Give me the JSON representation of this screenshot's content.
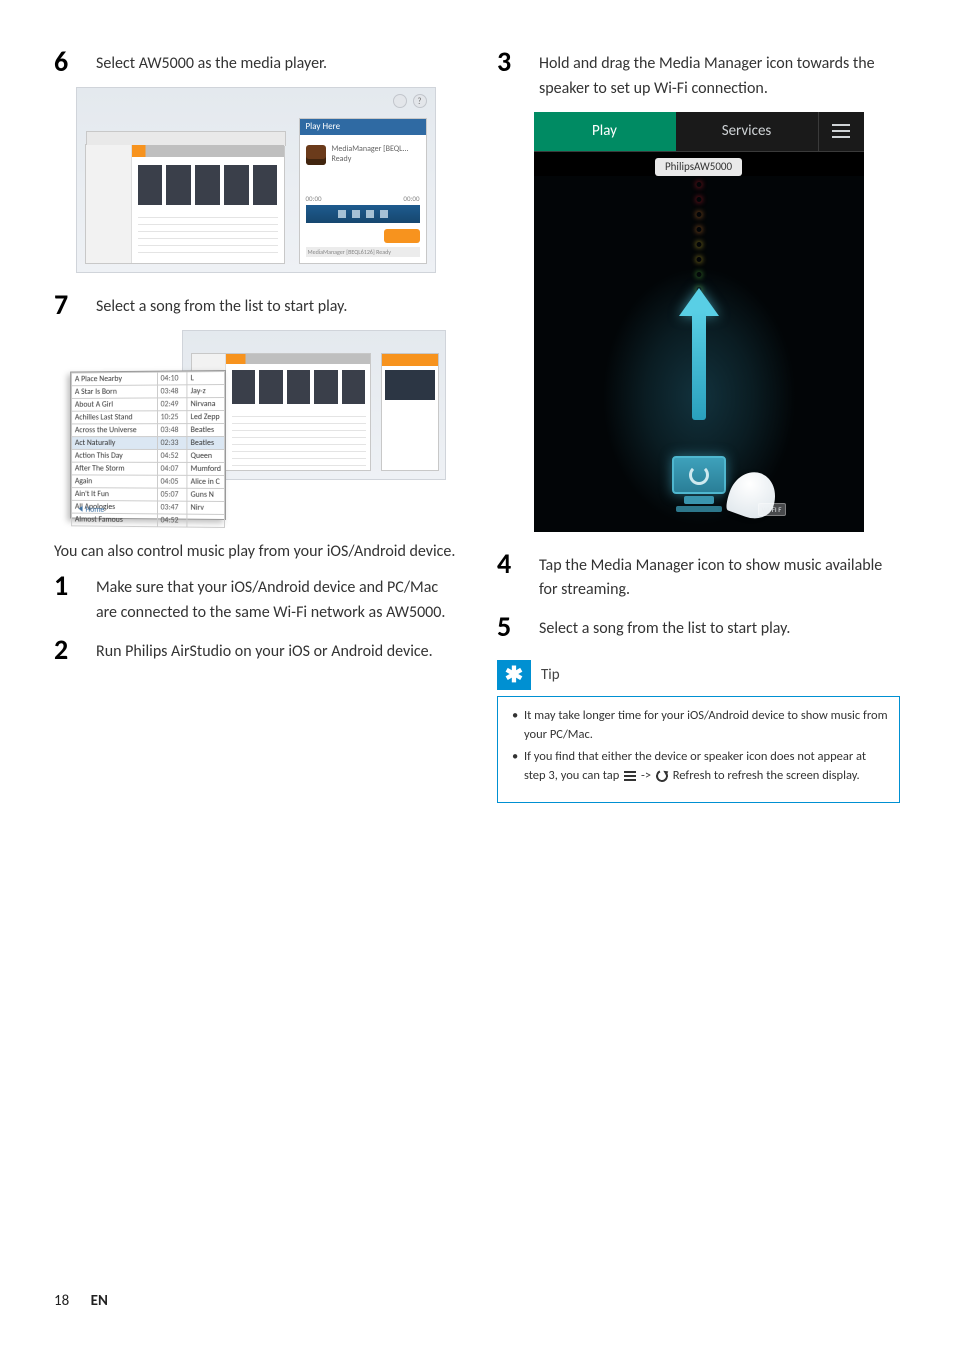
{
  "left": {
    "step6": {
      "num": "6",
      "text": "Select AW5000 as the media player."
    },
    "step7": {
      "num": "7",
      "text": "Select a song from the list to start play."
    },
    "paragraph": "You can also control music play from your iOS/Android device.",
    "sub1": {
      "num": "1",
      "text_a": "Make sure that your iOS/Android device and PC/Mac are connected to the same Wi-Fi network as AW5000."
    },
    "sub2": {
      "num": "2",
      "text_a": "Run ",
      "bold": "Philips AirStudio",
      "text_b": " on your iOS or Android device."
    }
  },
  "right": {
    "step3": {
      "num": "3",
      "text": "Hold and drag the Media Manager icon towards the speaker to set up Wi-Fi connection."
    },
    "step4": {
      "num": "4",
      "text": "Tap the Media Manager icon to show music available for streaming."
    },
    "step5": {
      "num": "5",
      "text": "Select a song from the list to start play."
    }
  },
  "fig6": {
    "help1": " ",
    "help2": "?",
    "play_here": "Play Here",
    "device_line1": "MediaManager [BEQL...",
    "device_line2": "Ready",
    "time_a": "00:00",
    "time_b": "00:00",
    "bottom_label": "MediaManager [BEQL6126] Ready"
  },
  "fig7": {
    "songs": [
      {
        "t": "A Place Nearby",
        "d": "04:10",
        "a": "L"
      },
      {
        "t": "A Star Is Born",
        "d": "03:48",
        "a": "Jay-z"
      },
      {
        "t": "About A Girl",
        "d": "02:49",
        "a": "Nirvana"
      },
      {
        "t": "Achilles Last Stand",
        "d": "10:25",
        "a": "Led Zepp"
      },
      {
        "t": "Across the Universe",
        "d": "03:48",
        "a": "Beatles"
      },
      {
        "t": "Act Naturally",
        "d": "02:33",
        "a": "Beatles"
      },
      {
        "t": "Action This Day",
        "d": "04:52",
        "a": "Queen"
      },
      {
        "t": "After The Storm",
        "d": "04:07",
        "a": "Mumford"
      },
      {
        "t": "Again",
        "d": "04:05",
        "a": "Alice in C"
      },
      {
        "t": "Ain't It Fun",
        "d": "05:07",
        "a": "Guns N"
      },
      {
        "t": "All Apologies",
        "d": "03:47",
        "a": "Nirv"
      },
      {
        "t": "Almost Famous",
        "d": "04:52",
        "a": ""
      }
    ],
    "home": "Home"
  },
  "phone": {
    "tab_play": "Play",
    "tab_services": "Services",
    "pill": "PhilipsAW5000",
    "wifi": "WI-FI F"
  },
  "tip": {
    "label": "Tip",
    "li1": "It may take longer time for your iOS/Android device to show music from your PC/Mac.",
    "li2_a": "If you find that either the device or speaker icon does not appear at step 3, you can tap ",
    "li2_b": " -> ",
    "li2_c": " Refresh",
    "li2_d": " to refresh the screen display."
  },
  "footer": {
    "page": "18",
    "lang": "EN"
  }
}
